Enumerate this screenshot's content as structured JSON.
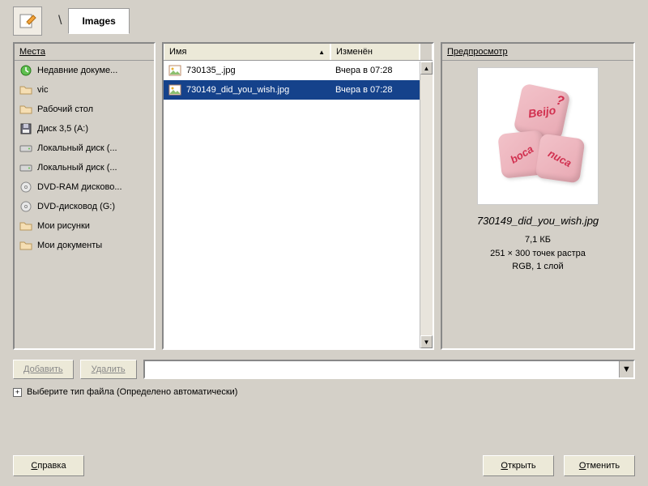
{
  "tabs": {
    "current": "Images"
  },
  "places": {
    "header": "Места",
    "items": [
      {
        "label": "Недавние докуме...",
        "icon": "recent"
      },
      {
        "label": "vic",
        "icon": "folder"
      },
      {
        "label": "Рабочий стол",
        "icon": "folder"
      },
      {
        "label": "Диск 3,5 (A:)",
        "icon": "floppy"
      },
      {
        "label": "Локальный диск (...",
        "icon": "hdd"
      },
      {
        "label": "Локальный диск (...",
        "icon": "hdd"
      },
      {
        "label": "DVD-RAM дисково...",
        "icon": "optical"
      },
      {
        "label": "DVD-дисковод (G:)",
        "icon": "optical"
      },
      {
        "label": "Мои рисунки",
        "icon": "folder"
      },
      {
        "label": "Мои документы",
        "icon": "folder"
      }
    ]
  },
  "filelist": {
    "columns": {
      "name": "Имя",
      "modified": "Изменён"
    },
    "rows": [
      {
        "name": "730135_.jpg",
        "modified": "Вчера в 07:28",
        "selected": false
      },
      {
        "name": "730149_did_you_wish.jpg",
        "modified": "Вчера в 07:28",
        "selected": true
      }
    ]
  },
  "preview": {
    "header": "Предпросмотр",
    "filename": "730149_did_you_wish.jpg",
    "size": "7,1 КБ",
    "dimensions": "251 × 300 точек растра",
    "mode": "RGB, 1 слой",
    "dice": {
      "top": "Beijo",
      "left": "boca",
      "right": "nuca",
      "q": "?"
    }
  },
  "buttons": {
    "add": "Добавить",
    "remove": "Удалить",
    "help": "Справка",
    "open": "Открыть",
    "cancel": "Отменить"
  },
  "filetype": {
    "label": "Выберите тип файла (Определено автоматически)"
  },
  "breadcrumb_sep": "\\"
}
